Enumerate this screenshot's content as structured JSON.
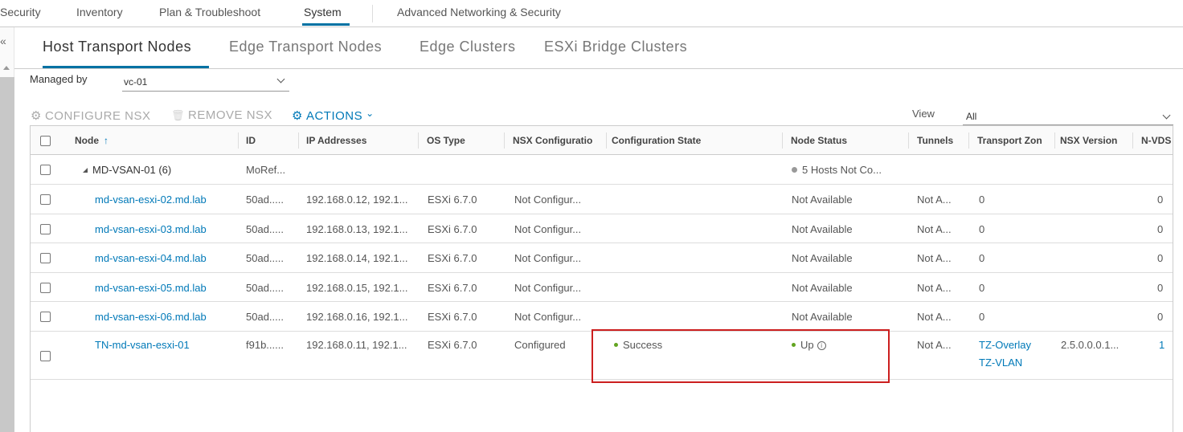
{
  "top_nav": {
    "items": [
      {
        "label": "Security",
        "active": false
      },
      {
        "label": "Inventory",
        "active": false
      },
      {
        "label": "Plan & Troubleshoot",
        "active": false
      },
      {
        "label": "System",
        "active": true
      },
      {
        "label": "Advanced Networking & Security",
        "active": false
      }
    ]
  },
  "collapse_icon": "«",
  "sub_tabs": [
    {
      "label": "Host Transport Nodes",
      "active": true
    },
    {
      "label": "Edge Transport Nodes",
      "active": false
    },
    {
      "label": "Edge Clusters",
      "active": false
    },
    {
      "label": "ESXi Bridge Clusters",
      "active": false
    }
  ],
  "filter": {
    "managed_by_label": "Managed by",
    "managed_by_value": "vc-01",
    "view_label": "View",
    "view_value": "All"
  },
  "toolbar": {
    "configure_label": "CONFIGURE NSX",
    "remove_label": "REMOVE NSX",
    "actions_label": "ACTIONS",
    "configure_icon": "⚙",
    "remove_icon": "🗑",
    "actions_icon": "⚙",
    "actions_chevron": "⌄"
  },
  "grid": {
    "columns": [
      {
        "label": "Node",
        "sort": "↑"
      },
      {
        "label": "ID"
      },
      {
        "label": "IP Addresses"
      },
      {
        "label": "OS Type"
      },
      {
        "label": "NSX Configuratio"
      },
      {
        "label": "Configuration State"
      },
      {
        "label": "Node Status"
      },
      {
        "label": "Tunnels"
      },
      {
        "label": "Transport Zon"
      },
      {
        "label": "NSX Version"
      },
      {
        "label": "N-VDS"
      }
    ],
    "rows": [
      {
        "node": "MD-VSAN-01 (6)",
        "group": true,
        "id": "MoRef...",
        "ip": "",
        "os": "",
        "nsx_config": "",
        "config_state": "",
        "node_status": "5 Hosts Not Co...",
        "node_status_color": "#999999",
        "tunnels": "",
        "tz": [],
        "nsx_version": "",
        "nvds": ""
      },
      {
        "node": "md-vsan-esxi-02.md.lab",
        "id": "50ad.....",
        "ip": "192.168.0.12, 192.1...",
        "os": "ESXi 6.7.0",
        "nsx_config": "Not Configur...",
        "config_state": "",
        "node_status": "Not Available",
        "tunnels": "Not A...",
        "tz": [
          "0"
        ],
        "nsx_version": "",
        "nvds": "0"
      },
      {
        "node": "md-vsan-esxi-03.md.lab",
        "id": "50ad.....",
        "ip": "192.168.0.13, 192.1...",
        "os": "ESXi 6.7.0",
        "nsx_config": "Not Configur...",
        "config_state": "",
        "node_status": "Not Available",
        "tunnels": "Not A...",
        "tz": [
          "0"
        ],
        "nsx_version": "",
        "nvds": "0"
      },
      {
        "node": "md-vsan-esxi-04.md.lab",
        "id": "50ad.....",
        "ip": "192.168.0.14, 192.1...",
        "os": "ESXi 6.7.0",
        "nsx_config": "Not Configur...",
        "config_state": "",
        "node_status": "Not Available",
        "tunnels": "Not A...",
        "tz": [
          "0"
        ],
        "nsx_version": "",
        "nvds": "0"
      },
      {
        "node": "md-vsan-esxi-05.md.lab",
        "id": "50ad.....",
        "ip": "192.168.0.15, 192.1...",
        "os": "ESXi 6.7.0",
        "nsx_config": "Not Configur...",
        "config_state": "",
        "node_status": "Not Available",
        "tunnels": "Not A...",
        "tz": [
          "0"
        ],
        "nsx_version": "",
        "nvds": "0"
      },
      {
        "node": "md-vsan-esxi-06.md.lab",
        "id": "50ad.....",
        "ip": "192.168.0.16, 192.1...",
        "os": "ESXi 6.7.0",
        "nsx_config": "Not Configur...",
        "config_state": "",
        "node_status": "Not Available",
        "tunnels": "Not A...",
        "tz": [
          "0"
        ],
        "nsx_version": "",
        "nvds": "0"
      },
      {
        "node": "TN-md-vsan-esxi-01",
        "id": "f91b......",
        "ip": "192.168.0.11, 192.1...",
        "os": "ESXi 6.7.0",
        "nsx_config": "Configured",
        "config_state": "Success",
        "config_state_color": "#62a420",
        "node_status": "Up",
        "node_status_color": "#62a420",
        "node_status_info": "ⓘ",
        "tunnels": "Not A...",
        "tz": [
          "TZ-Overlay",
          "TZ-VLAN"
        ],
        "tz_link": true,
        "nsx_version": "2.5.0.0.0.1...",
        "nvds": "1",
        "nvds_link": true
      }
    ]
  },
  "colors": {
    "accent": "#0072a3",
    "link": "#0079b8",
    "success": "#62a420",
    "highlight": "#cc1f1f"
  }
}
